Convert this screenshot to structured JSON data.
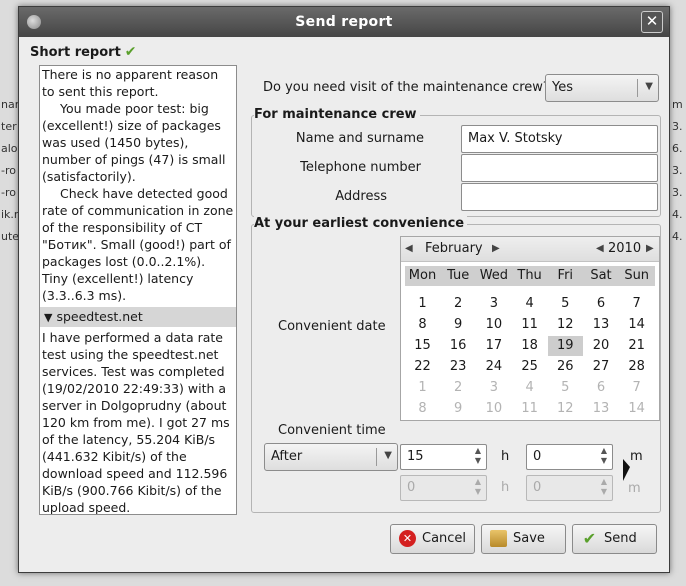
{
  "dialog": {
    "title": "Send report"
  },
  "left": {
    "title": "Short report",
    "paragraphs": [
      "There is no apparent reason to sent this report.",
      "You made poor test: big (excellent!) size of packages was used (1450 bytes), number of pings (47) is small (satisfactorily).",
      "Check have detected good rate of communication in zone of the responsibility of CT \"Ботик\". Small (good!) part of packages lost (0.0..2.1%). Tiny (excellent!) latency (3.3..6.3 ms)."
    ],
    "expander_label": "speedtest.net",
    "expander_text": "I have performed a data rate test using the speedtest.net services.  Test was completed (19/02/2010 22:49:33) with a server in Dolgoprudny (about 120 km from me).  I got 27 ms of the latency, 55.204 KiB/s (441.632 Kibit/s) of the download speed and 112.596 KiB/s (900.766 Kibit/s) of the upload speed."
  },
  "visit": {
    "question": "Do you need visit of the maintenance crew?",
    "value": "Yes"
  },
  "crew": {
    "title": "For maintenance crew",
    "name_label": "Name and surname",
    "name_value": "Max V. Stotsky",
    "phone_label": "Telephone number",
    "phone_value": "",
    "address_label": "Address",
    "address_value": ""
  },
  "convenience": {
    "title": "At your earliest convenience",
    "date_label": "Convenient date",
    "time_label": "Convenient time",
    "time_mode": "After",
    "hours": "15",
    "minutes": "0",
    "hours2": "0",
    "minutes2": "0",
    "h_unit": "h",
    "m_unit": "m"
  },
  "calendar": {
    "month": "February",
    "year": "2010",
    "weekdays": [
      "Mon",
      "Tue",
      "Wed",
      "Thu",
      "Fri",
      "Sat",
      "Sun"
    ],
    "weeks": [
      [
        [
          "1",
          0
        ],
        [
          "2",
          0
        ],
        [
          "3",
          0
        ],
        [
          "4",
          0
        ],
        [
          "5",
          0
        ],
        [
          "6",
          0
        ],
        [
          "7",
          0
        ]
      ],
      [
        [
          "8",
          0
        ],
        [
          "9",
          0
        ],
        [
          "10",
          0
        ],
        [
          "11",
          0
        ],
        [
          "12",
          0
        ],
        [
          "13",
          0
        ],
        [
          "14",
          0
        ]
      ],
      [
        [
          "15",
          0
        ],
        [
          "16",
          0
        ],
        [
          "17",
          0
        ],
        [
          "18",
          0
        ],
        [
          "19",
          0
        ],
        [
          "20",
          0
        ],
        [
          "21",
          0
        ]
      ],
      [
        [
          "22",
          0
        ],
        [
          "23",
          0
        ],
        [
          "24",
          0
        ],
        [
          "25",
          0
        ],
        [
          "26",
          0
        ],
        [
          "27",
          0
        ],
        [
          "28",
          0
        ]
      ],
      [
        [
          "1",
          1
        ],
        [
          "2",
          1
        ],
        [
          "3",
          1
        ],
        [
          "4",
          1
        ],
        [
          "5",
          1
        ],
        [
          "6",
          1
        ],
        [
          "7",
          1
        ]
      ],
      [
        [
          "8",
          1
        ],
        [
          "9",
          1
        ],
        [
          "10",
          1
        ],
        [
          "11",
          1
        ],
        [
          "12",
          1
        ],
        [
          "13",
          1
        ],
        [
          "14",
          1
        ]
      ]
    ],
    "selected": "19"
  },
  "buttons": {
    "cancel": "Cancel",
    "save": "Save",
    "send": "Send"
  },
  "background": {
    "left_fragments": [
      "nar",
      "ter",
      "alov",
      "-ro",
      "-ro",
      "ik.r",
      "ute"
    ],
    "right_fragments": [
      "m",
      "3.",
      "6.",
      "3.",
      "3.",
      "4.",
      "4."
    ]
  },
  "colors": {
    "titlebar": "#4f4f4f",
    "check": "#5aa02c",
    "cancel_icon": "#d42020",
    "send_icon": "#5aa02c"
  }
}
